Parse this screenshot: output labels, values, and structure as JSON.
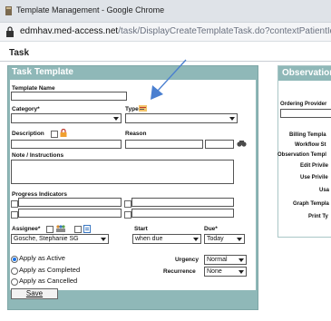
{
  "window": {
    "title": "Template Management - Google Chrome"
  },
  "address": {
    "host": "edmhav.med-access.net",
    "path": "/task/DisplayCreateTemplateTask.do?contextPatientId="
  },
  "page": {
    "title": "Task"
  },
  "task_template": {
    "heading": "Task Template",
    "template_name_label": "Template Name",
    "category_label": "Category*",
    "type_label": "Type",
    "description_label": "Description",
    "reason_label": "Reason",
    "note_label": "Note / Instructions",
    "progress_label": "Progress Indicators",
    "assignee_label": "Assignee*",
    "assignee_value": "Gosche, Stephanie SG",
    "start_label": "Start",
    "start_value": "when due",
    "due_label": "Due*",
    "due_value": "Today",
    "apply_active": "Apply as Active",
    "apply_completed": "Apply as Completed",
    "apply_cancelled": "Apply as Cancelled",
    "urgency_label": "Urgency",
    "urgency_value": "Normal",
    "recurrence_label": "Recurrence",
    "recurrence_value": "None",
    "save_label": "Save"
  },
  "observation": {
    "heading": "Observation",
    "ordering_provider": "Ordering Provider",
    "billing": "Billing Templa",
    "workflow": "Workflow St",
    "obs_template": "Observation Templ",
    "edit_priv": "Edit Privile",
    "use_priv": "Use Privile",
    "usa": "Usa",
    "graph": "Graph Templa",
    "print": "Print Ty"
  },
  "colors": {
    "panel": "#8fb8b8",
    "arrow": "#4a7fd0",
    "radio_selected": "#1a73e8"
  }
}
